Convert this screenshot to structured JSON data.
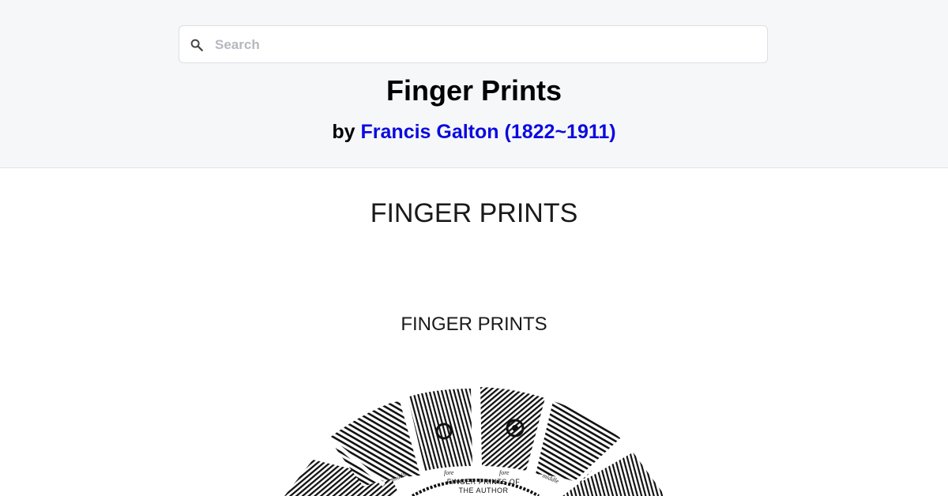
{
  "search": {
    "placeholder": "Search",
    "icon": "search-icon"
  },
  "book": {
    "title": "Finger Prints",
    "by_label": "by",
    "author": "Francis Galton (1822~1911)"
  },
  "content": {
    "heading": "FINGER PRINTS",
    "subheading": "FINGER PRINTS"
  },
  "frontispiece": {
    "caption_line1": "FINGER PRINTS OF",
    "caption_line2": "THE AUTHOR",
    "finger_labels": [
      "middle",
      "fore",
      "fore",
      "middle"
    ]
  },
  "colors": {
    "header_bg": "#f6f7f9",
    "author_link": "#0a0ae0"
  }
}
